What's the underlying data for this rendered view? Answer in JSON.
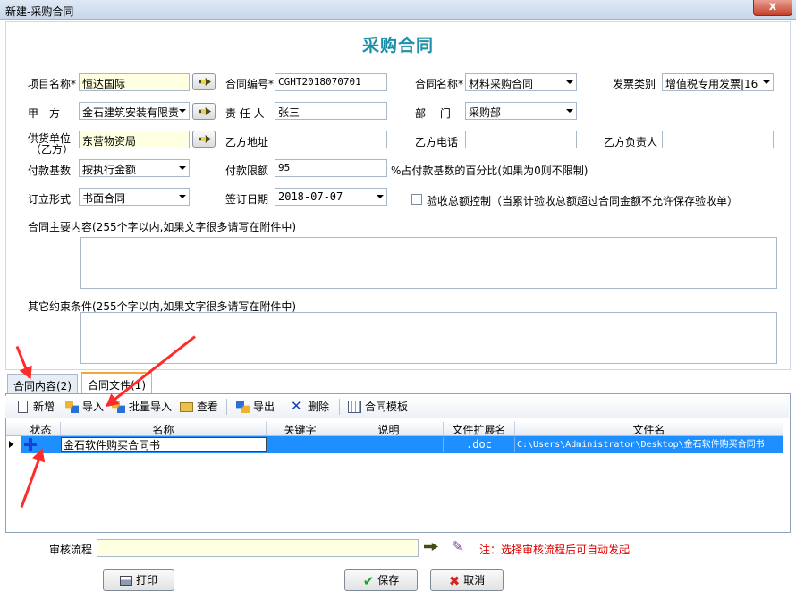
{
  "window": {
    "title": "新建-采购合同",
    "close_glyph": "x"
  },
  "form": {
    "title": "采购合同",
    "project_name": {
      "label": "项目名称*",
      "value": "恒达国际"
    },
    "contract_no": {
      "label": "合同编号*",
      "value": "CGHT2018070701"
    },
    "contract_name": {
      "label": "合同名称*",
      "value": "材料采购合同"
    },
    "invoice_type": {
      "label": "发票类别",
      "value": "增值税专用发票|16"
    },
    "party_a": {
      "label": "甲　方",
      "value": "金石建筑安装有限责"
    },
    "responsible": {
      "label": "责 任 人",
      "value": "张三"
    },
    "department": {
      "label": "部　 门",
      "value": "采购部"
    },
    "supplier": {
      "label_line1": "供货单位",
      "label_line2": "（乙方）",
      "value": "东营物资局"
    },
    "party_b_address": {
      "label": "乙方地址",
      "value": ""
    },
    "party_b_phone": {
      "label": "乙方电话",
      "value": ""
    },
    "party_b_owner": {
      "label": "乙方负责人",
      "value": ""
    },
    "payment_base": {
      "label": "付款基数",
      "value": "按执行金额"
    },
    "payment_limit": {
      "label": "付款限额",
      "value": "95",
      "note": "%占付款基数的百分比(如果为0则不限制)"
    },
    "sign_form": {
      "label": "订立形式",
      "value": "书面合同"
    },
    "sign_date": {
      "label": "签订日期",
      "value": "2018-07-07"
    },
    "acceptance_control": {
      "label": "验收总额控制（当累计验收总额超过合同金额不允许保存验收单）",
      "checked": false
    },
    "main_content": {
      "label": "合同主要内容(255个字以内,如果文字很多请写在附件中)",
      "value": ""
    },
    "other_terms": {
      "label": "其它约束条件(255个字以内,如果文字很多请写在附件中)",
      "value": ""
    }
  },
  "tabs": [
    {
      "label": "合同内容(2)",
      "active": false
    },
    {
      "label": "合同文件(1)",
      "active": true
    }
  ],
  "toolbar": {
    "add": "新增",
    "import": "导入",
    "batch_import": "批量导入",
    "view": "查看",
    "export": "导出",
    "delete": "删除",
    "template": "合同模板"
  },
  "grid": {
    "columns": [
      "状态",
      "名称",
      "关键字",
      "说明",
      "文件扩展名",
      "文件名"
    ],
    "rows": [
      {
        "status_icon": "plus-icon",
        "name": "金石软件购买合同书",
        "keyword": "",
        "description": "",
        "ext": ".doc",
        "filename": "C:\\Users\\Administrator\\Desktop\\金石软件购买合同书"
      }
    ]
  },
  "approval": {
    "label": "审核流程",
    "value": "",
    "hint": "注：选择审核流程后可自动发起"
  },
  "buttons": {
    "print": "打印",
    "save": "保存",
    "cancel": "取消"
  },
  "colors": {
    "accent": "#1d8fa8",
    "selection": "#1e8fff",
    "annotation": "#ff2a2a",
    "hint": "#e00000"
  }
}
